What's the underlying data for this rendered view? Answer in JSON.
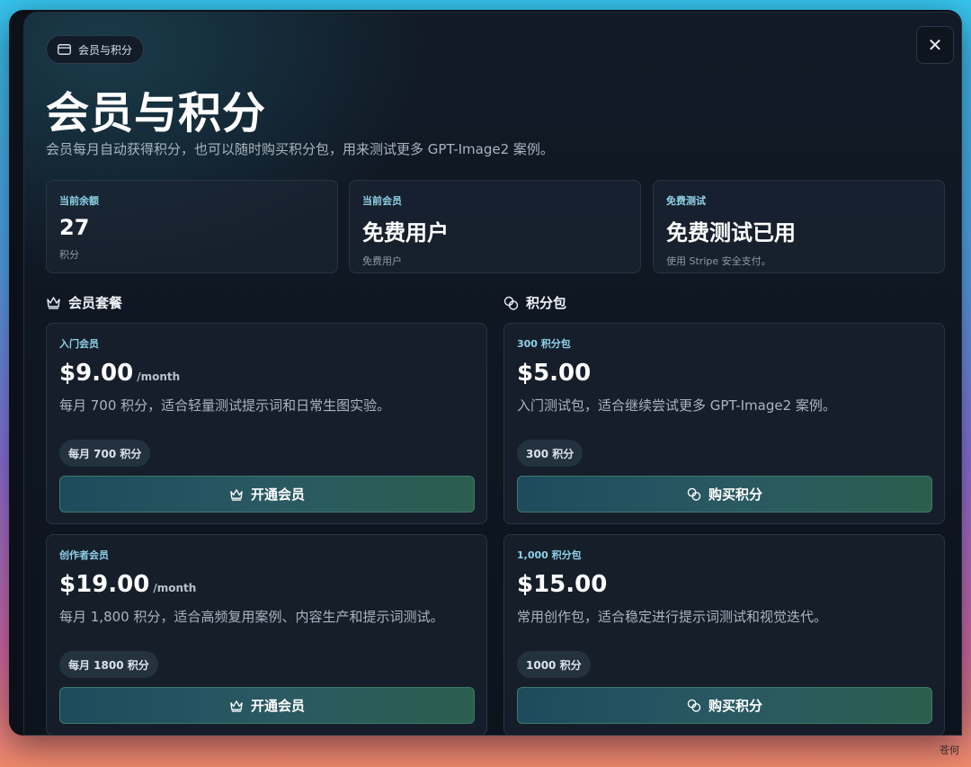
{
  "header": {
    "badge_label": "会员与积分",
    "title": "会员与积分",
    "subtitle": "会员每月自动获得积分，也可以随时购买积分包，用来测试更多 GPT-Image2 案例。",
    "close_symbol": "✕"
  },
  "stats": [
    {
      "label": "当前余额",
      "value": "27",
      "note": "积分"
    },
    {
      "label": "当前会员",
      "value": "免费用户",
      "note": "免费用户"
    },
    {
      "label": "免费测试",
      "value": "免费测试已用",
      "note": "使用 Stripe 安全支付。"
    }
  ],
  "memberships": {
    "heading": "会员套餐",
    "plans": [
      {
        "tag": "入门会员",
        "price": "$9.00",
        "period": "/month",
        "description": "每月 700 积分，适合轻量测试提示词和日常生图实验。",
        "pill": "每月 700 积分",
        "button": "开通会员"
      },
      {
        "tag": "创作者会员",
        "price": "$19.00",
        "period": "/month",
        "description": "每月 1,800 积分，适合高频复用案例、内容生产和提示词测试。",
        "pill": "每月 1800 积分",
        "button": "开通会员"
      }
    ]
  },
  "packs": {
    "heading": "积分包",
    "items": [
      {
        "tag": "300 积分包",
        "price": "$5.00",
        "description": "入门测试包，适合继续尝试更多 GPT-Image2 案例。",
        "pill": "300 积分",
        "button": "购买积分"
      },
      {
        "tag": "1,000 积分包",
        "price": "$15.00",
        "description": "常用创作包，适合稳定进行提示词测试和视觉迭代。",
        "pill": "1000 积分",
        "button": "购买积分"
      }
    ]
  },
  "watermark": "苍何",
  "icons": {
    "badge": "credit-card-icon",
    "close": "close-icon",
    "membership": "crown-icon",
    "packs": "coins-icon"
  },
  "colors": {
    "accent_label": "#8fd2e8",
    "button_start": "#1e4b5c",
    "button_end": "#2c5e4e",
    "button_border": "#3c7a66",
    "modal_bg": "#0d131d"
  }
}
